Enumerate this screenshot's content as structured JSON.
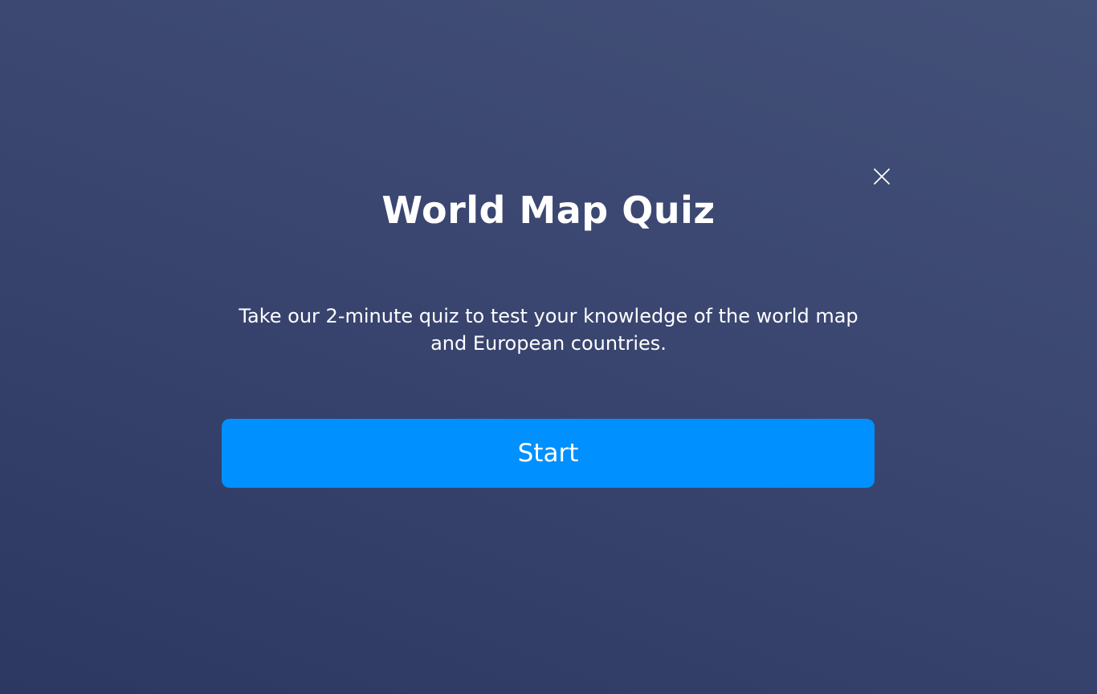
{
  "modal": {
    "title": "World Map Quiz",
    "description": "Take our 2-minute quiz to test your knowledge of the world map and European countries.",
    "start_label": "Start",
    "close_icon": "close-icon"
  },
  "colors": {
    "background_top": "#435078",
    "background_bottom": "#2d3862",
    "button": "#0090ff",
    "text": "#ffffff"
  }
}
